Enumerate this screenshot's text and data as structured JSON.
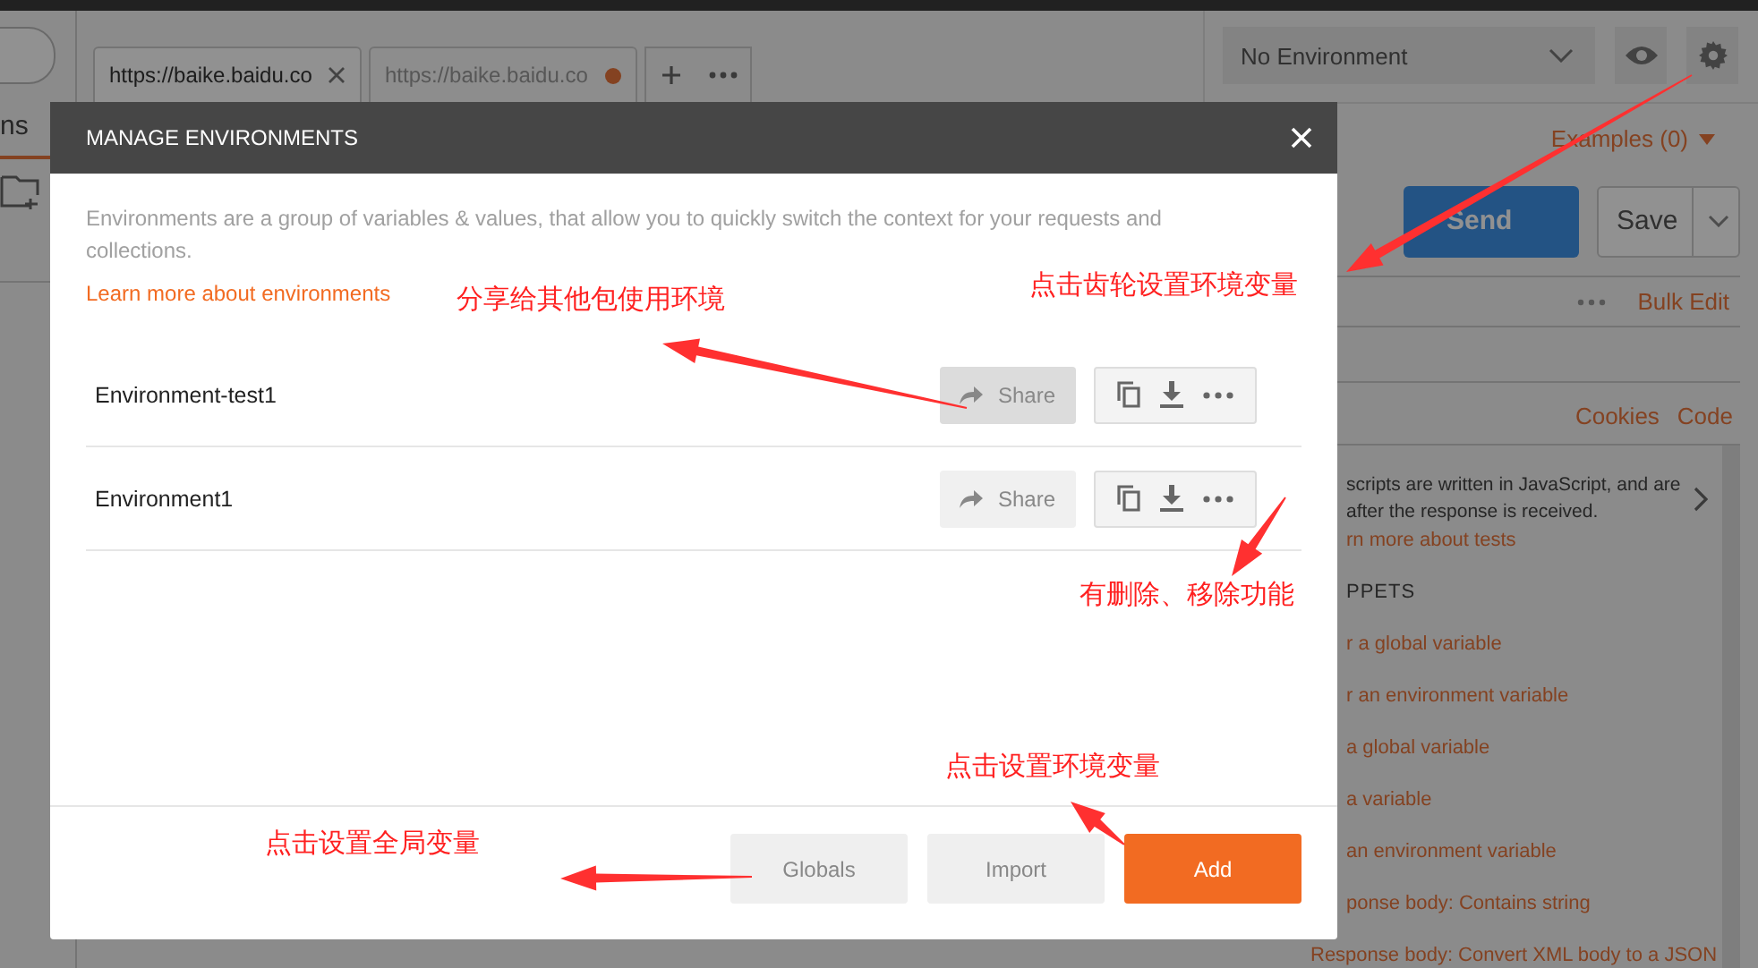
{
  "app": {
    "sidebar_tab": "ns",
    "tabs": [
      {
        "label": "https://baike.baidu.co",
        "selected": true,
        "unsaved": false
      },
      {
        "label": "https://baike.baidu.co",
        "selected": false,
        "unsaved": true
      }
    ],
    "environment_select": "No Environment",
    "examples": "Examples (0)",
    "send": "Send",
    "save": "Save",
    "bulk_edit": "Bulk Edit",
    "response_links": [
      "Cookies",
      "Code"
    ],
    "tests_info": "scripts are written in JavaScript, and are after the response is received.",
    "tests_link": "rn more about tests",
    "snippets_heading": "PPETS",
    "snippets": [
      "r a global variable",
      "r an environment variable",
      "a global variable",
      "a variable",
      "an environment variable",
      "ponse body: Contains string",
      "Response body: Convert XML body to a JSON"
    ]
  },
  "modal": {
    "title": "MANAGE ENVIRONMENTS",
    "description": "Environments are a group of variables & values, that allow you to quickly switch the context for your requests and collections.",
    "link": "Learn more about environments",
    "environments": [
      {
        "name": "Environment-test1",
        "share": "Share",
        "highlighted": true
      },
      {
        "name": "Environment1",
        "share": "Share",
        "highlighted": false
      }
    ],
    "buttons": [
      {
        "label": "Globals",
        "kind": "secondary"
      },
      {
        "label": "Import",
        "kind": "secondary"
      },
      {
        "label": "Add",
        "kind": "primary"
      }
    ]
  },
  "annotations": [
    "点击齿轮设置环境变量",
    "分享给其他包使用环境",
    "有删除、移除功能",
    "点击设置环境变量",
    "点击设置全局变量"
  ]
}
